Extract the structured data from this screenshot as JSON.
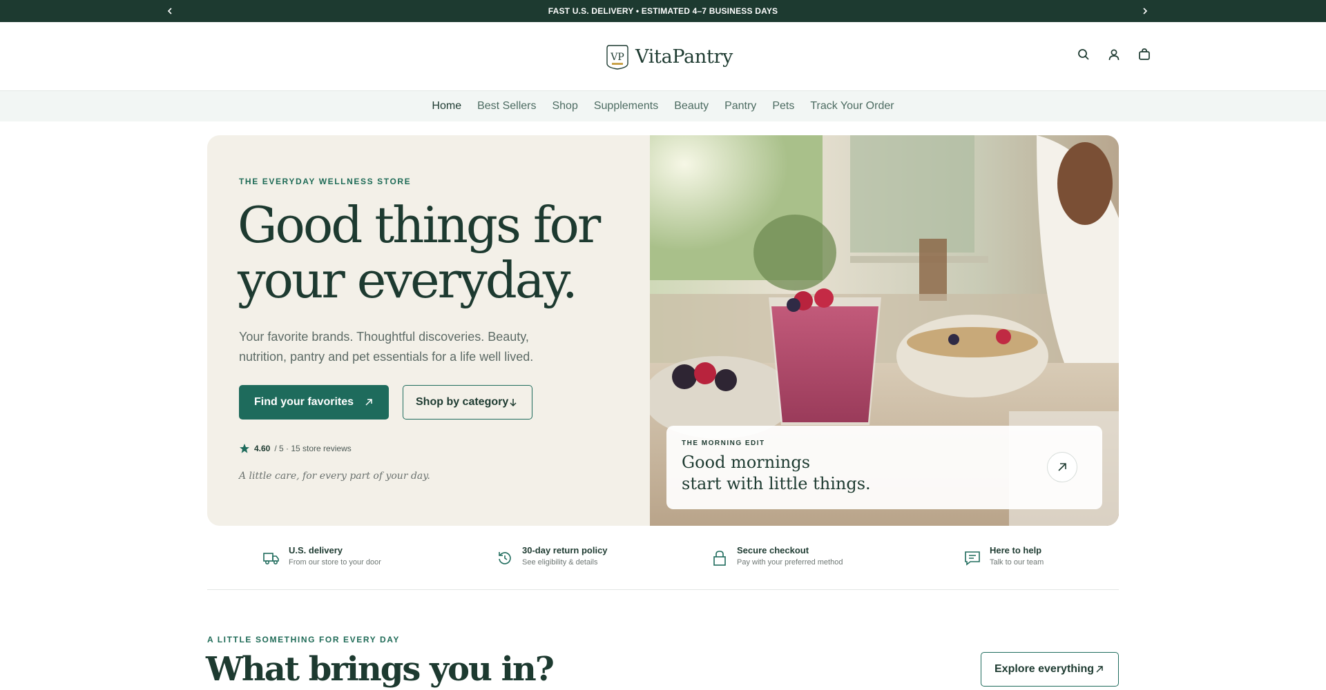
{
  "announcement": {
    "text": "FAST U.S. DELIVERY • ESTIMATED 4–7 BUSINESS DAYS",
    "prev_icon": "chevron-left-icon",
    "next_icon": "chevron-right-icon"
  },
  "header": {
    "brand": "VitaPantry",
    "logo_monogram": "VP",
    "icons": [
      "search-icon",
      "account-icon",
      "cart-icon"
    ]
  },
  "nav": {
    "items": [
      "Home",
      "Best Sellers",
      "Shop",
      "Supplements",
      "Beauty",
      "Pantry",
      "Pets",
      "Track Your Order"
    ],
    "active": "Home"
  },
  "hero": {
    "eyebrow": "THE EVERYDAY WELLNESS STORE",
    "title_line1": "Good things for",
    "title_line2": "your everyday.",
    "subtitle": "Your favorite brands. Thoughtful discoveries. Beauty, nutrition, pantry and pet essentials for a life well lived.",
    "primary_button": "Find your favorites",
    "secondary_button": "Shop by category",
    "rating_value": "4.60",
    "rating_suffix": "/ 5 · 15 store reviews",
    "tagline": "A little care, for every part of your day."
  },
  "morning_card": {
    "eyebrow": "THE MORNING EDIT",
    "title_line1": "Good mornings",
    "title_line2": "start with little things."
  },
  "trust": [
    {
      "icon": "truck-icon",
      "title": "U.S. delivery",
      "desc": "From our store to your door"
    },
    {
      "icon": "return-icon",
      "title": "30-day return policy",
      "desc": "See eligibility & details"
    },
    {
      "icon": "lock-icon",
      "title": "Secure checkout",
      "desc": "Pay with your preferred method"
    },
    {
      "icon": "chat-icon",
      "title": "Here to help",
      "desc": "Talk to our team"
    }
  ],
  "section": {
    "eyebrow": "A LITTLE SOMETHING FOR EVERY DAY",
    "title": "What brings you in?",
    "button": "Explore everything"
  },
  "colors": {
    "brand_dark": "#1d3a30",
    "brand_green": "#1e6b5c",
    "hero_bg": "#f3f0e8",
    "nav_bg": "#f2f6f4"
  }
}
